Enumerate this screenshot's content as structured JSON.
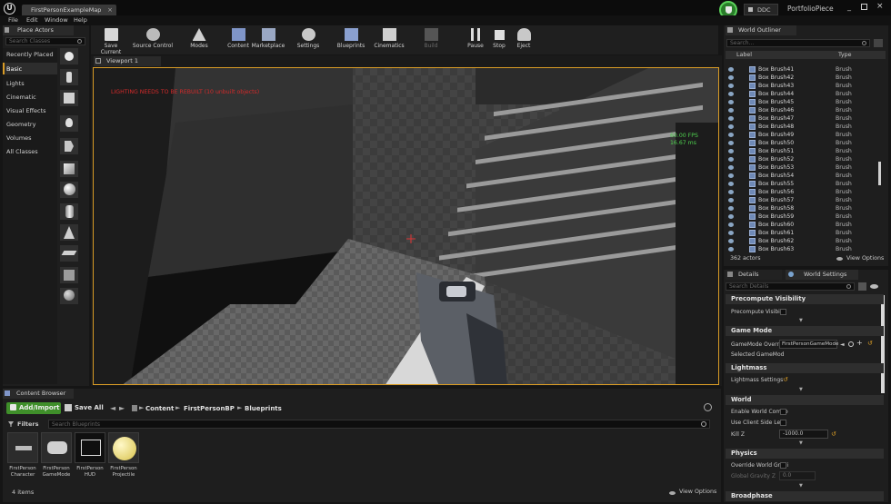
{
  "window": {
    "tab_title": "FirstPersonExampleMap",
    "project_name": "PortfolioPiece",
    "ddc_label": "DDC"
  },
  "menu": [
    "File",
    "Edit",
    "Window",
    "Help"
  ],
  "place_actors": {
    "tab_label": "Place Actors",
    "search_placeholder": "Search Classes",
    "categories": [
      "Recently Placed",
      "Basic",
      "Lights",
      "Cinematic",
      "Visual Effects",
      "Geometry",
      "Volumes",
      "All Classes"
    ],
    "selected_category": "Basic"
  },
  "toolbar": {
    "save_current": "Save Current",
    "source_control": "Source Control",
    "modes": "Modes",
    "content": "Content",
    "marketplace": "Marketplace",
    "settings": "Settings",
    "blueprints": "Blueprints",
    "cinematics": "Cinematics",
    "build": "Build",
    "pause": "Pause",
    "stop": "Stop",
    "eject": "Eject"
  },
  "viewport": {
    "tab_label": "Viewport 1",
    "warning": "LIGHTING NEEDS TO BE REBUILT (10 unbuilt objects)",
    "fps": "60.00 FPS",
    "ms": "16.67 ms"
  },
  "world_outliner": {
    "tab_label": "World Outliner",
    "search_placeholder": "Search...",
    "col_label": "Label",
    "col_type": "Type",
    "rows": [
      {
        "label": "Box Brush41",
        "type": "Brush"
      },
      {
        "label": "Box Brush42",
        "type": "Brush"
      },
      {
        "label": "Box Brush43",
        "type": "Brush"
      },
      {
        "label": "Box Brush44",
        "type": "Brush"
      },
      {
        "label": "Box Brush45",
        "type": "Brush"
      },
      {
        "label": "Box Brush46",
        "type": "Brush"
      },
      {
        "label": "Box Brush47",
        "type": "Brush"
      },
      {
        "label": "Box Brush48",
        "type": "Brush"
      },
      {
        "label": "Box Brush49",
        "type": "Brush"
      },
      {
        "label": "Box Brush50",
        "type": "Brush"
      },
      {
        "label": "Box Brush51",
        "type": "Brush"
      },
      {
        "label": "Box Brush52",
        "type": "Brush"
      },
      {
        "label": "Box Brush53",
        "type": "Brush"
      },
      {
        "label": "Box Brush54",
        "type": "Brush"
      },
      {
        "label": "Box Brush55",
        "type": "Brush"
      },
      {
        "label": "Box Brush56",
        "type": "Brush"
      },
      {
        "label": "Box Brush57",
        "type": "Brush"
      },
      {
        "label": "Box Brush58",
        "type": "Brush"
      },
      {
        "label": "Box Brush59",
        "type": "Brush"
      },
      {
        "label": "Box Brush60",
        "type": "Brush"
      },
      {
        "label": "Box Brush61",
        "type": "Brush"
      },
      {
        "label": "Box Brush62",
        "type": "Brush"
      },
      {
        "label": "Box Brush63",
        "type": "Brush"
      }
    ],
    "actor_count": "362 actors",
    "view_options": "View Options"
  },
  "details": {
    "tab_details": "Details",
    "tab_world_settings": "World Settings",
    "search_placeholder": "Search Details",
    "sections": {
      "precomputed_visibility": "Precompute Visibility",
      "game_mode": "Game Mode",
      "lightmass": "Lightmass",
      "world": "World",
      "physics": "Physics",
      "broadphase": "Broadphase"
    },
    "props": {
      "precompute_visibility": "Precompute Visibilit",
      "gamemode_override": "GameMode Override",
      "gamemode_value": "FirstPersonGameMode",
      "selected_gamemode": "Selected GameMod",
      "lightmass_settings": "Lightmass Settings",
      "enable_world_composition": "Enable World Compo",
      "use_client_side_level": "Use Client Side Leve",
      "kill_z": "Kill Z",
      "kill_z_value": "-1000.0",
      "override_world_gravity": "Override World Gravi",
      "global_gravity_z": "Global Gravity Z",
      "global_gravity_value": "0.0"
    }
  },
  "content_browser": {
    "tab_label": "Content Browser",
    "add_import": "Add/Import",
    "save_all": "Save All",
    "path": [
      "Content",
      "FirstPersonBP",
      "Blueprints"
    ],
    "filters": "Filters",
    "search_placeholder": "Search Blueprints",
    "assets": [
      {
        "line1": "FirstPerson",
        "line2": "Character"
      },
      {
        "line1": "FirstPerson",
        "line2": "GameMode"
      },
      {
        "line1": "FirstPerson",
        "line2": "HUD"
      },
      {
        "line1": "FirstPerson",
        "line2": "Projectile"
      }
    ],
    "item_count": "4 items",
    "view_options": "View Options"
  }
}
